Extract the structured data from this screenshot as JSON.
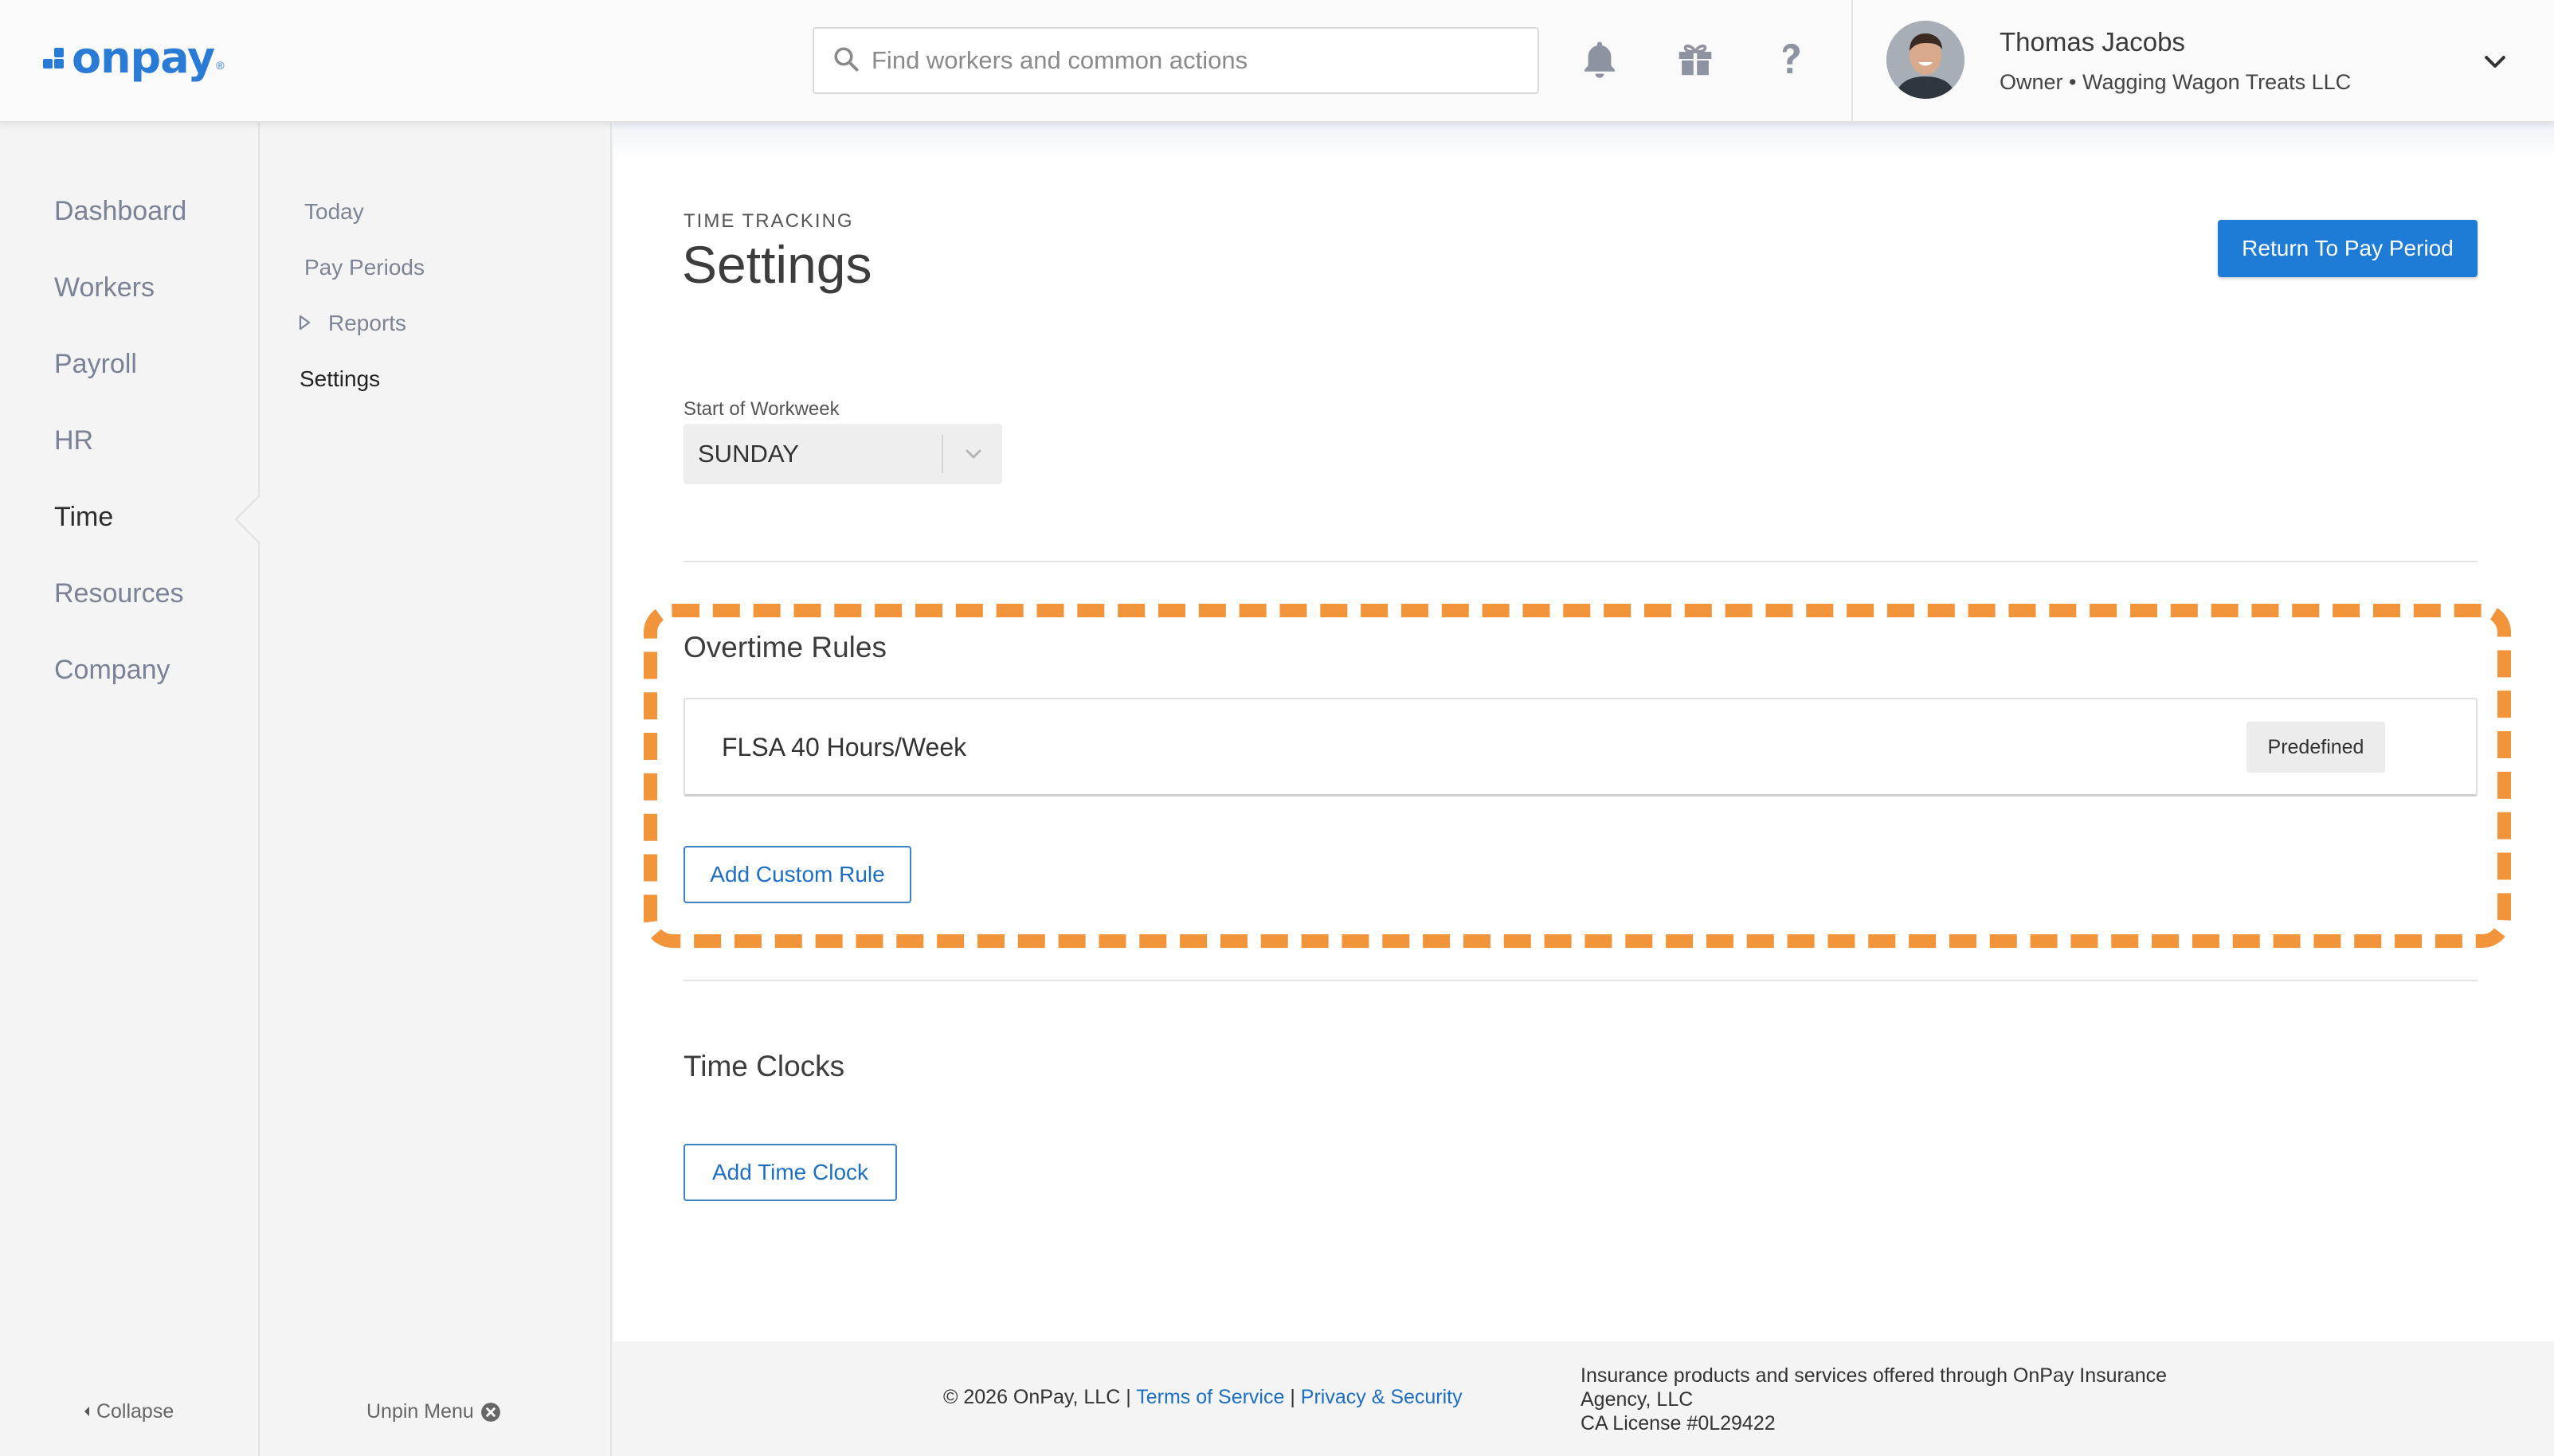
{
  "brand": {
    "name": "onpay",
    "registered": "®"
  },
  "search": {
    "placeholder": "Find workers and common actions"
  },
  "user": {
    "name": "Thomas Jacobs",
    "subtitle": "Owner • Wagging Wagon Treats LLC"
  },
  "primary_nav": {
    "items": [
      "Dashboard",
      "Workers",
      "Payroll",
      "HR",
      "Time",
      "Resources",
      "Company"
    ],
    "active": "Time",
    "collapse_label": "Collapse"
  },
  "secondary_nav": {
    "items": [
      "Today",
      "Pay Periods",
      "Reports",
      "Settings"
    ],
    "active": "Settings",
    "unpin_label": "Unpin Menu"
  },
  "page": {
    "eyebrow": "TIME TRACKING",
    "title": "Settings",
    "return_button": "Return To Pay Period"
  },
  "workweek": {
    "label": "Start of Workweek",
    "value": "SUNDAY"
  },
  "overtime": {
    "title": "Overtime Rules",
    "rules": [
      {
        "name": "FLSA 40 Hours/Week",
        "badge": "Predefined"
      }
    ],
    "add_button": "Add Custom Rule"
  },
  "time_clocks": {
    "title": "Time Clocks",
    "add_button": "Add Time Clock"
  },
  "footer": {
    "copyright": "© 2026 OnPay, LLC",
    "separator": "|",
    "terms": "Terms of Service",
    "privacy": "Privacy & Security",
    "insurance_line1": "Insurance products and services offered through OnPay Insurance",
    "insurance_line2": "Agency, LLC",
    "license": "CA License #0L29422"
  },
  "colors": {
    "brand_blue": "#2a7bd5",
    "primary_button": "#1e7bd6",
    "highlight_dash": "#f1943a",
    "link": "#1e6fc1"
  },
  "icons": [
    "search-icon",
    "bell-icon",
    "gift-icon",
    "help-icon",
    "chevron-down-icon",
    "caret-right-icon",
    "close-circle-icon",
    "caret-left-icon"
  ]
}
